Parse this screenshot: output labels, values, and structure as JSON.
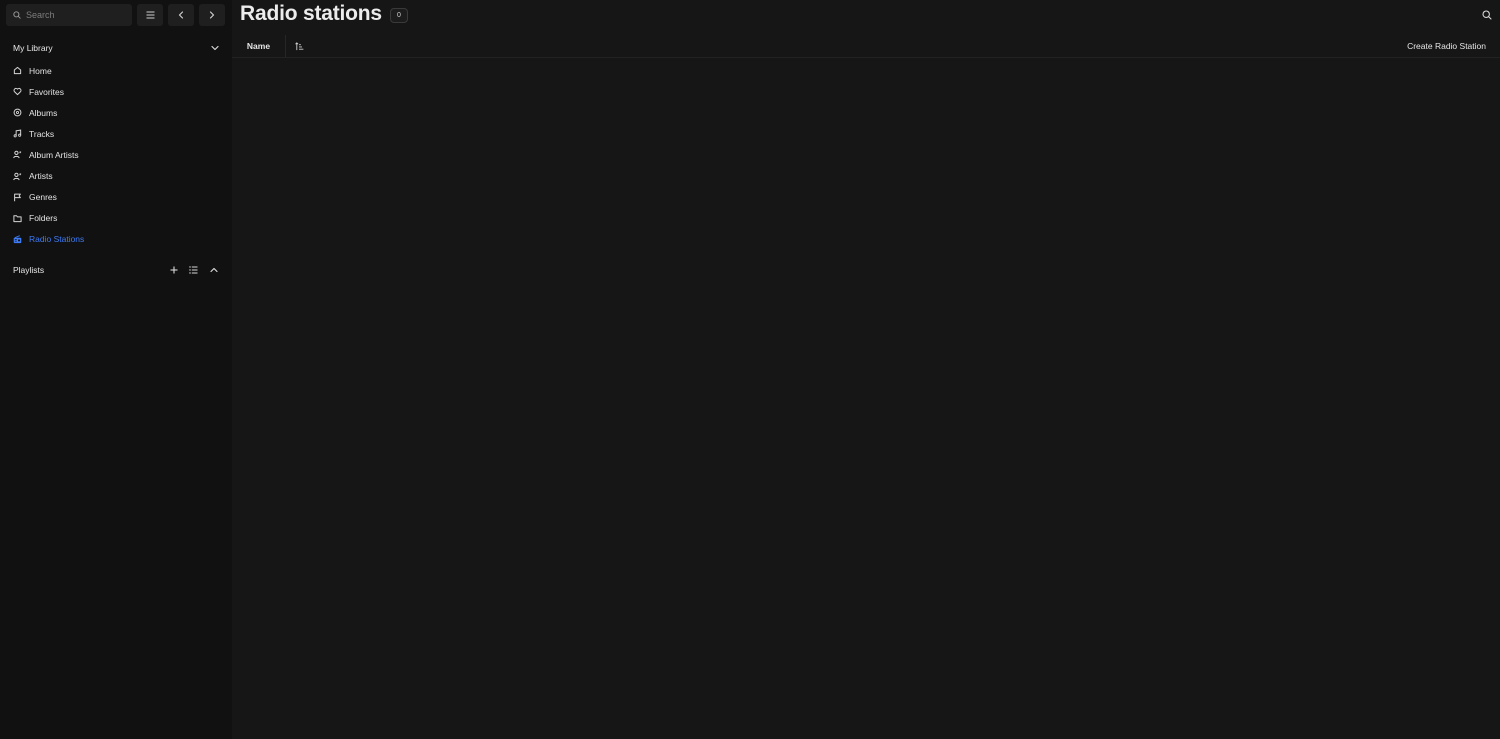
{
  "sidebar": {
    "search": {
      "placeholder": "Search",
      "value": ""
    },
    "library": {
      "title": "My Library",
      "items": [
        {
          "label": "Home",
          "icon": "home-icon"
        },
        {
          "label": "Favorites",
          "icon": "heart-icon"
        },
        {
          "label": "Albums",
          "icon": "disc-icon"
        },
        {
          "label": "Tracks",
          "icon": "music-note-icon"
        },
        {
          "label": "Album Artists",
          "icon": "user-star-icon"
        },
        {
          "label": "Artists",
          "icon": "user-star-icon"
        },
        {
          "label": "Genres",
          "icon": "flag-icon"
        },
        {
          "label": "Folders",
          "icon": "folder-icon"
        },
        {
          "label": "Radio Stations",
          "icon": "radio-icon",
          "active": true
        }
      ]
    },
    "playlists": {
      "title": "Playlists"
    }
  },
  "main": {
    "title": "Radio stations",
    "count": "0",
    "toolbar": {
      "sort_field": "Name",
      "create_label": "Create Radio Station"
    }
  },
  "colors": {
    "accent": "#3d7bf5",
    "background": "#161616",
    "sidebar_background": "#111111"
  }
}
